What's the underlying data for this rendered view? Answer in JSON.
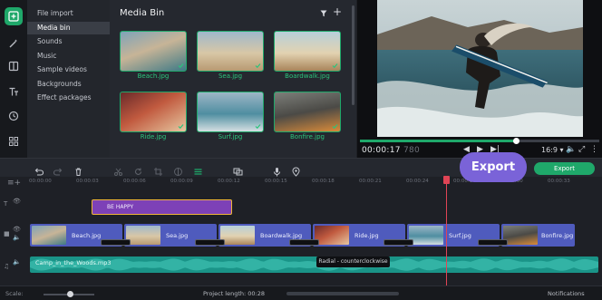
{
  "menu": {
    "items": [
      {
        "label": "File import",
        "selected": false
      },
      {
        "label": "Media bin",
        "selected": true
      },
      {
        "label": "Sounds",
        "selected": false
      },
      {
        "label": "Music",
        "selected": false
      },
      {
        "label": "Sample videos",
        "selected": false
      },
      {
        "label": "Backgrounds",
        "selected": false
      },
      {
        "label": "Effect packages",
        "selected": false
      }
    ]
  },
  "rail": {
    "icons": [
      "import-icon",
      "magic-wand-icon",
      "transitions-icon",
      "titles-icon",
      "clock-icon",
      "grid-icon"
    ]
  },
  "bin": {
    "title": "Media Bin",
    "items": [
      {
        "label": "Beach.jpg"
      },
      {
        "label": "Sea.jpg"
      },
      {
        "label": "Boardwalk.jpg"
      },
      {
        "label": "Ride.jpg"
      },
      {
        "label": "Surf.jpg"
      },
      {
        "label": "Bonfire.jpg"
      }
    ]
  },
  "preview": {
    "timecode": "00:00:17",
    "timecode_ms": "780",
    "aspect": "16:9",
    "progress_fraction": 0.65
  },
  "toolbar": {
    "export_label": "Export",
    "callout_label": "Export"
  },
  "ruler": {
    "ticks": [
      "00:00:00",
      "00:00:03",
      "00:00:06",
      "00:00:09",
      "00:00:12",
      "00:00:15",
      "00:00:18",
      "00:00:21",
      "00:00:24",
      "00:00:27",
      "00:00:30",
      "00:00:33"
    ]
  },
  "timeline": {
    "title_clip": "BE HAPPY",
    "video_clips": [
      {
        "label": "Beach.jpg"
      },
      {
        "label": "Sea.jpg"
      },
      {
        "label": "Boardwalk.jpg"
      },
      {
        "label": "Ride.jpg"
      },
      {
        "label": "Surf.jpg"
      },
      {
        "label": "Bonfire.jpg"
      }
    ],
    "audio_clip": "Camp_in_the_Woods.mp3",
    "tooltip": "Radial - counterclockwise"
  },
  "status": {
    "scale_label": "Scale:",
    "project_length": "Project length: 00:28",
    "notifications": "Notifications"
  },
  "colors": {
    "accent": "#1fa86a",
    "callout": "#7a63d8",
    "title_clip": "#7d41b7",
    "video_clip": "#4f5bbd",
    "audio_clip": "#1a9488",
    "playhead": "#e04455"
  }
}
